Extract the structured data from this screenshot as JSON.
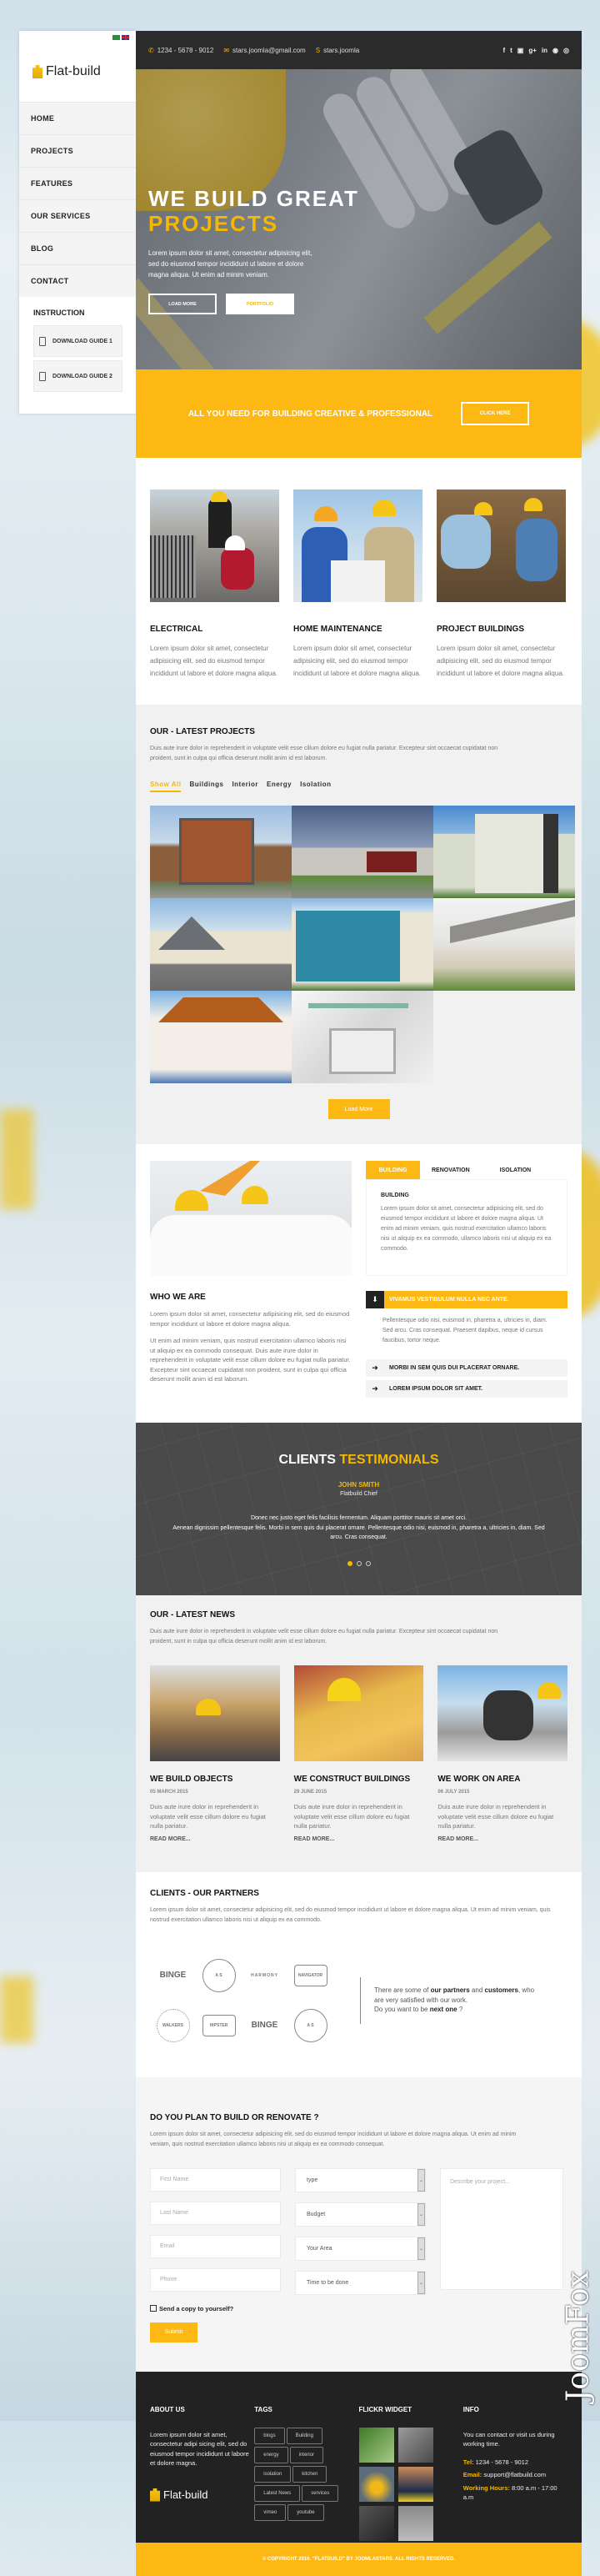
{
  "sidebar": {
    "brand": "Flat-build",
    "languages": [
      "Arabic",
      "English"
    ],
    "nav": [
      "HOME",
      "PROJECTS",
      "FEATURES",
      "OUR SERVICES",
      "BLOG",
      "CONTACT"
    ],
    "instruction_title": "INSTRUCTION",
    "downloads": [
      "DOWNLOAD GUIDE 1",
      "DOWNLOAD GUIDE 2"
    ]
  },
  "topbar": {
    "phone": "1234 - 5678 - 9012",
    "email": "stars.joomla@gmail.com",
    "skype": "stars.joomla",
    "socials": [
      "facebook",
      "twitter",
      "youtube",
      "google-plus",
      "linkedin",
      "pinterest",
      "dribbble"
    ],
    "social_glyphs": [
      "f",
      "t",
      "▣",
      "g+",
      "in",
      "◉",
      "◎"
    ]
  },
  "hero": {
    "title_line1": "WE BUILD GREAT",
    "title_line2": "PROJECTS",
    "text": "Lorem ipsum dolor sit amet, consectetur adipisicing elit, sed do eiusmod tempor incididunt ut labore et dolore magna aliqua. Ut enim ad minim veniam.",
    "btn_load_more": "LOAD MORE",
    "btn_portfolio": "PORTFOLIO"
  },
  "cta": {
    "text": "ALL YOU NEED FOR BUILDING CREATIVE & PROFESSIONAL",
    "button": "CLICK HERE"
  },
  "services": [
    {
      "title": "ELECTRICAL",
      "text": "Lorem ipsum dolor sit amet, consectetur adipisicing elit, sed do eiusmod tempor incididunt ut labore et dolore magna aliqua."
    },
    {
      "title": "HOME MAINTENANCE",
      "text": "Lorem ipsum dolor sit amet, consectetur adipisicing elit, sed do eiusmod tempor incididunt ut labore et dolore magna aliqua."
    },
    {
      "title": "PROJECT BUILDINGS",
      "text": "Lorem ipsum dolor sit amet, consectetur adipisicing elit, sed do eiusmod tempor incididunt ut labore et dolore magna aliqua."
    }
  ],
  "projects": {
    "title": "OUR - LATEST PROJECTS",
    "desc": "Duis aute irure dolor in reprehenderit in voluptate velit esse cillum dolore eu fugiat nulla pariatur. Excepteur sint occaecat cupidatat non proident, sunt in culpa qui officia deserunt mollit anim id est laborum.",
    "filters": [
      "Show All",
      "Buildings",
      "Interior",
      "Energy",
      "Isolation"
    ],
    "active_filter": "Show All",
    "items": [
      "apartment-building",
      "single-story-house",
      "modern-villa",
      "cottage-house",
      "blue-modern-house",
      "flat-roof-house",
      "wooden-villa",
      "construction-plan"
    ],
    "load_more": "Load More"
  },
  "about": {
    "title": "WHO WE ARE",
    "p1": "Lorem ipsum dolor sit amet, consectetur adipisicing elit, sed do eiusmod tempor incididunt ut labore et dolore magna aliqua.",
    "p2": "Ut enim ad minim veniam, quis nostrud exercitation ullamco laboris nisi ut aliquip ex ea commodo consequat. Duis aute irure dolor in reprehenderit in voluptate velit esse cillum dolore eu fugiat nulla pariatur. Excepteur sint occaecat cupidatat non proident, sunt in culpa qui officia deserunt mollit anim id est laborum.",
    "tabs": [
      "BUILDING",
      "RENOVATION",
      "ISOLATION"
    ],
    "tab_title": "BUILDING",
    "tab_text": "Lorem ipsum dolor sit amet, consectetur adipisicing elit, sed do eiusmod tempor incididunt ut labore et dolore magna aliqua. Ut enim ad minim veniam, quis nostrud exercitation ullamco laboris nisi ut aliquip ex ea commodo, ullamco laboris nisi ut aliquip ex ea commodo.",
    "accordion": [
      {
        "title": "VIVAMUS VESTIBULUM NULLA NEC ANTE.",
        "body": "Pellentesque odio nisi, euismod in, pharetra a, ultricies in, diam. Sed arcu. Cras consequat. Praesent dapibus, neque id cursus faucibus, tortor neque."
      },
      {
        "title": "MORBI IN SEM QUIS DUI PLACERAT ORNARE."
      },
      {
        "title": "LOREM IPSUM DOLOR SIT AMET."
      }
    ]
  },
  "testimonials": {
    "title_white": "CLIENTS",
    "title_yellow": "TESTIMONIALS",
    "name": "JOHN SMITH",
    "role": "Flatbuild Chief",
    "quote_line1": "Donec nec justo eget felis facilisis fermentum. Aliquam porttitor mauris sit amet orci.",
    "quote_line2": "Aenean dignissim pellentesque felis. Morbi in sem quis dui placerat ornare. Pellentesque odio nisi, euismod in, pharetra a, ultricies in, diam. Sed arcu. Cras consequat.",
    "slides": 3,
    "active_slide": 1
  },
  "news": {
    "title": "OUR - LATEST NEWS",
    "desc": "Duis aute irure dolor in reprehenderit in voluptate velit esse cillum dolore eu fugiat nulla pariatur. Excepteur sint occaecat cupidatat non proident, sunt in culpa qui officia deserunt mollit anim id est laborum.",
    "items": [
      {
        "title": "WE BUILD OBJECTS",
        "date": "05 MARCH 2015",
        "text": "Duis aute irure dolor in reprehenderit in voluptate velit esse cillum dolore eu fugiat nulla pariatur.",
        "more": "READ MORE..."
      },
      {
        "title": "WE CONSTRUCT BUILDINGS",
        "date": "29 JUNE 2015",
        "text": "Duis aute irure dolor in reprehenderit in voluptate velit esse cillum dolore eu fugiat nulla pariatur.",
        "more": "READ MORE..."
      },
      {
        "title": "WE WORK ON AREA",
        "date": "06 JULY 2015",
        "text": "Duis aute irure dolor in reprehenderit in voluptate velit esse cillum dolore eu fugiat nulla pariatur.",
        "more": "READ MORE..."
      }
    ]
  },
  "partners": {
    "title": "CLIENTS - OUR PARTNERS",
    "desc": "Lorem ipsum dolor sit amet, consectetur adipisicing elit, sed do eiusmod tempor incididunt ut labore et dolore magna aliqua. Ut enim ad minim veniam, quis nostrud exercitation ullamco laboris nisi ut aliquip ex ea commodo.",
    "logos": [
      "BINGE",
      "A S",
      "HARMONY",
      "NAVIGATOR",
      "WALKERS",
      "HIPSTER",
      "BINGE",
      "A S"
    ],
    "text_pre": "There are some of ",
    "text_b1": "our partners",
    "text_mid": " and ",
    "text_b2": "customers",
    "text_post": ", who are very satisfied with our work.",
    "text_q_pre": "Do you want to be ",
    "text_q_b": "next one",
    "text_q_post": " ?"
  },
  "form": {
    "title": "DO YOU PLAN TO BUILD OR RENOVATE ?",
    "desc": "Lorem ipsum dolor sit amet, consectetur adipisicing elit, sed do eiusmod tempor incididunt ut labore et dolore magna aliqua. Ut enim ad minim veniam, quis nostrud exercitation ullamco laboris nisi ut aliquip ex ea commodo consequat.",
    "first_name": "First Name",
    "last_name": "Last Name",
    "email": "Email",
    "phone": "Phone",
    "type": "type",
    "budget": "Budget",
    "area": "Your Area",
    "time": "Time to be done",
    "describe": "Describe your project...",
    "copy_label": "Send a copy to yourself?",
    "submit": "Submit"
  },
  "footer": {
    "about_title": "ABOUT US",
    "about_text": "Lorem ipsum dolor sit amet, consectetur adipi sicing elit, sed do eiusmod tempor incididunt ut labore et dolore magna.",
    "brand": "Flat-build",
    "tags_title": "TAGS",
    "tags": [
      "blogs",
      "Building",
      "energy",
      "interior",
      "isolation",
      "kitchen",
      "Latest News",
      "services",
      "vimeo",
      "youtube"
    ],
    "flickr_title": "FLICKR WIDGET",
    "info_title": "INFO",
    "info_text": "You can contact or visit us during working time.",
    "tel_label": "Tel:",
    "tel": "1234 - 5678 - 9012",
    "email_label": "Email:",
    "email": "support@flatbuild.com",
    "hours_label": "Working Hours:",
    "hours": "8:00 a.m - 17:00 a.m",
    "copyright": "© COPYRIGHT 2016. \"FLATBUILD\" BY JOOMLASTARS. ALL RIGHTS RESERVED."
  },
  "watermark": "JoomFox",
  "colors": {
    "accent": "#fdb813",
    "dark": "#222222",
    "topbar": "#2b2b2b"
  }
}
